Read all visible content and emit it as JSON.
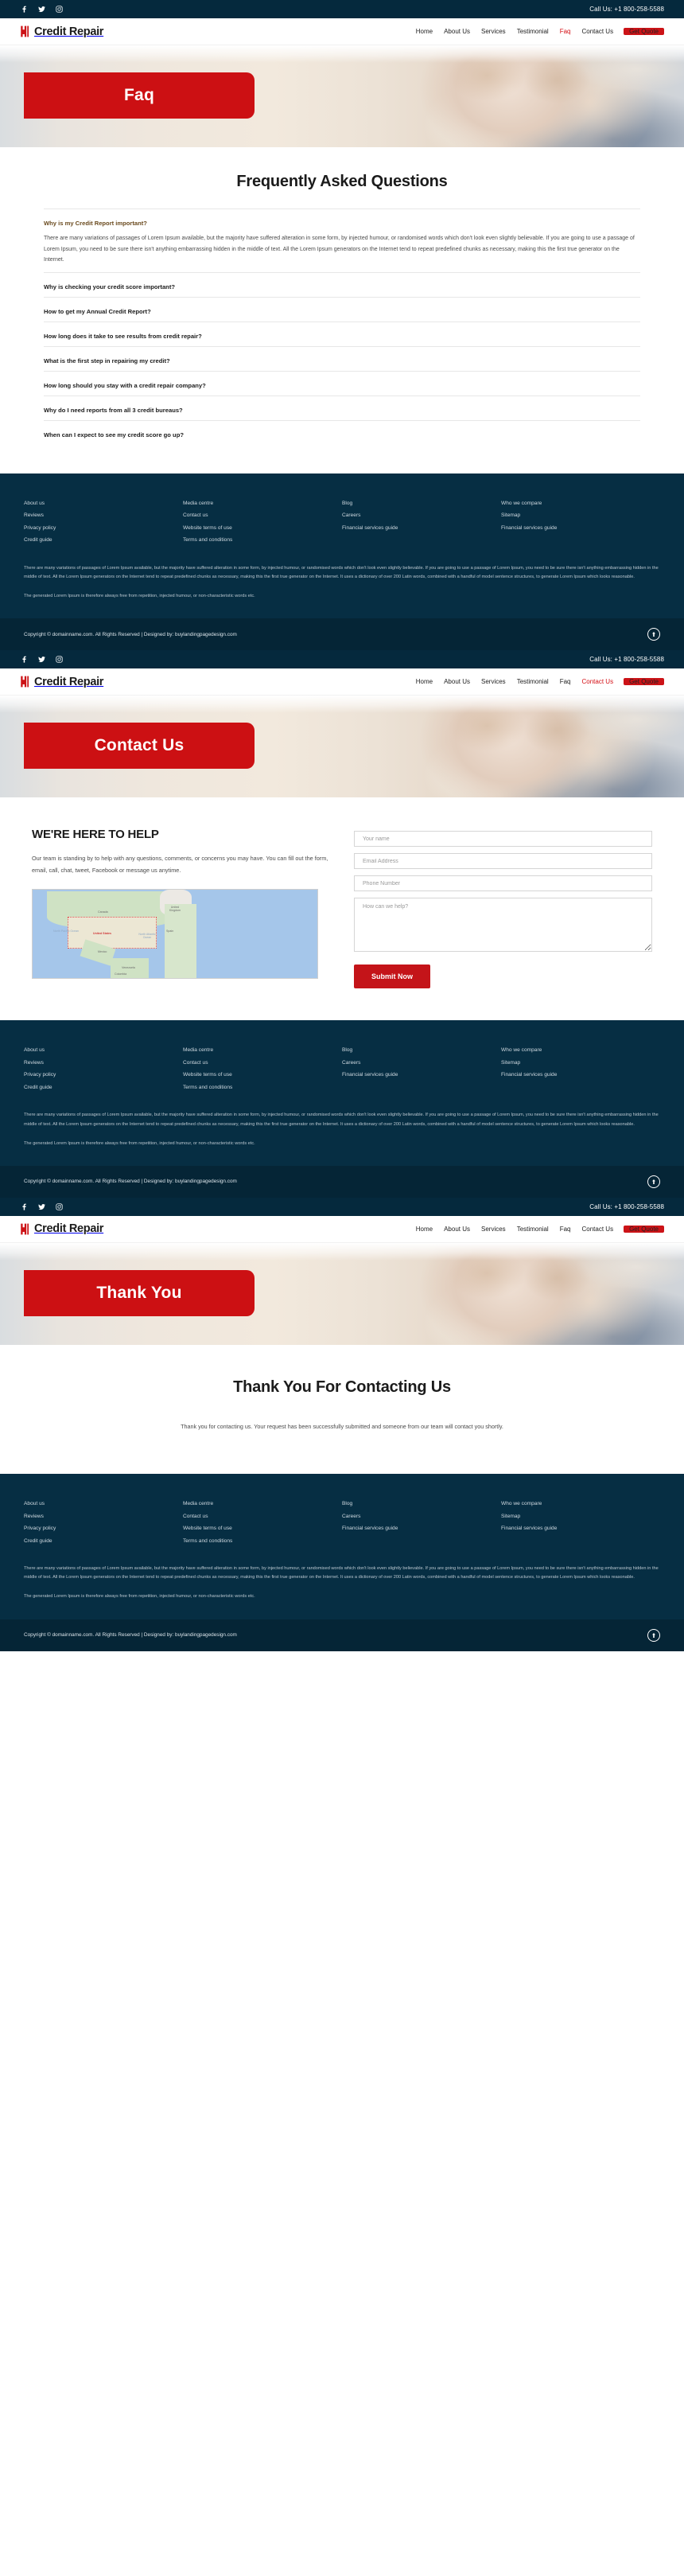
{
  "brand": {
    "name": "Credit Repair",
    "mark_icon": "credit-repair-logo-icon"
  },
  "topbar": {
    "call_label": "Call Us: +1 800-258-5588",
    "social": [
      {
        "name": "facebook-icon"
      },
      {
        "name": "twitter-icon"
      },
      {
        "name": "instagram-icon"
      }
    ]
  },
  "nav": {
    "items": [
      "Home",
      "About Us",
      "Services",
      "Testimonial",
      "Faq",
      "Contact Us"
    ],
    "cta": "Get Quote",
    "active": {
      "faq_page": "Faq",
      "contact_page": "Contact Us",
      "thankyou_page": ""
    }
  },
  "colors": {
    "accent_red": "#cc1317",
    "hero_red": "#cc1013",
    "footer_navy": "#062e43",
    "footer_bar_navy": "#052536",
    "topbar_navy": "#05293d",
    "nav_active_red": "#d40e14"
  },
  "faq_page": {
    "hero_title": "Faq",
    "section_title": "Frequently Asked Questions",
    "items": [
      {
        "question": "Why is my Credit Report important?",
        "open": true,
        "answer": "There are many variations of passages of Lorem Ipsum available, but the majority have suffered alteration in some form, by injected humour, or randomised words which don't look even slightly believable. If you are going to use a passage of Lorem Ipsum, you need to be sure there isn't anything embarrassing hidden in the middle of text. All the Lorem Ipsum generators on the Internet tend to repeat predefined chunks as necessary, making this the first true generator on the Internet."
      },
      {
        "question": "Why is checking your credit score important?",
        "open": false,
        "answer": ""
      },
      {
        "question": "How to get my Annual Credit Report?",
        "open": false,
        "answer": ""
      },
      {
        "question": "How long does it take to see results from credit repair?",
        "open": false,
        "answer": ""
      },
      {
        "question": "What is the first step in repairing my credit?",
        "open": false,
        "answer": ""
      },
      {
        "question": "How long should you stay with a credit repair company?",
        "open": false,
        "answer": ""
      },
      {
        "question": "Why do I need reports from all 3 credit bureaus?",
        "open": false,
        "answer": ""
      },
      {
        "question": "When can I expect to see my credit score go up?",
        "open": false,
        "answer": ""
      }
    ]
  },
  "contact_page": {
    "hero_title": "Contact Us",
    "heading": "WE'RE HERE TO HELP",
    "paragraph": "Our team is standing by to help with any questions, comments, or concerns you may have. You can fill out the form, email, call, chat, tweet, Facebook or message us anytime.",
    "map": {
      "labels": [
        "Canada",
        "United States",
        "Mexico",
        "Venezuela",
        "Colombia",
        "North Pacific Ocean",
        "North Atlantic Ocean",
        "United Kingdom",
        "Spain"
      ]
    },
    "form": {
      "name_placeholder": "Your name",
      "email_placeholder": "Email Address",
      "phone_placeholder": "Phone Number",
      "message_placeholder": "How can we help?",
      "name_value": "",
      "email_value": "",
      "phone_value": "",
      "message_value": "",
      "submit_label": "Submit Now"
    }
  },
  "thankyou_page": {
    "hero_title": "Thank You",
    "heading": "Thank You For Contacting Us",
    "paragraph": "Thank you for contacting us. Your request has been successfully submitted and someone from our team will contact you shortly."
  },
  "footer": {
    "columns": [
      {
        "links": [
          "About us",
          "Reviews",
          "Privacy policy",
          "Credit guide"
        ]
      },
      {
        "links": [
          "Media centre",
          "Contact us",
          "Website terms of use",
          "Terms and conditions"
        ]
      },
      {
        "links": [
          "Blog",
          "Careers",
          "Financial services guide"
        ]
      },
      {
        "links": [
          "Who we compare",
          "Sitemap",
          "Financial services guide"
        ]
      }
    ],
    "paragraph_1": "There are many variations of passages of Lorem Ipsum available, but the majority have suffered alteration in some form, by injected humour, or randomised words which don't look even slightly believable. If you are going to use a passage of Lorem Ipsum, you need to be sure there isn't anything embarrassing hidden in the middle of text. All the Lorem Ipsum generators on the Internet tend to repeat predefined chunks as necessary, making this the first true generator on the Internet. It uses a dictionary of over 200 Latin words, combined with a handful of model sentence structures, to generate Lorem Ipsum which looks reasonable.",
    "paragraph_2": "The generated Lorem Ipsum is therefore always free from repetition, injected humour, or non-characteristic words etc.",
    "copyright": "Copyright © domainname.com. All Rights Reserved | Designed by: buylandingpagedesign.com",
    "to_top_icon": "arrow-up-icon"
  }
}
